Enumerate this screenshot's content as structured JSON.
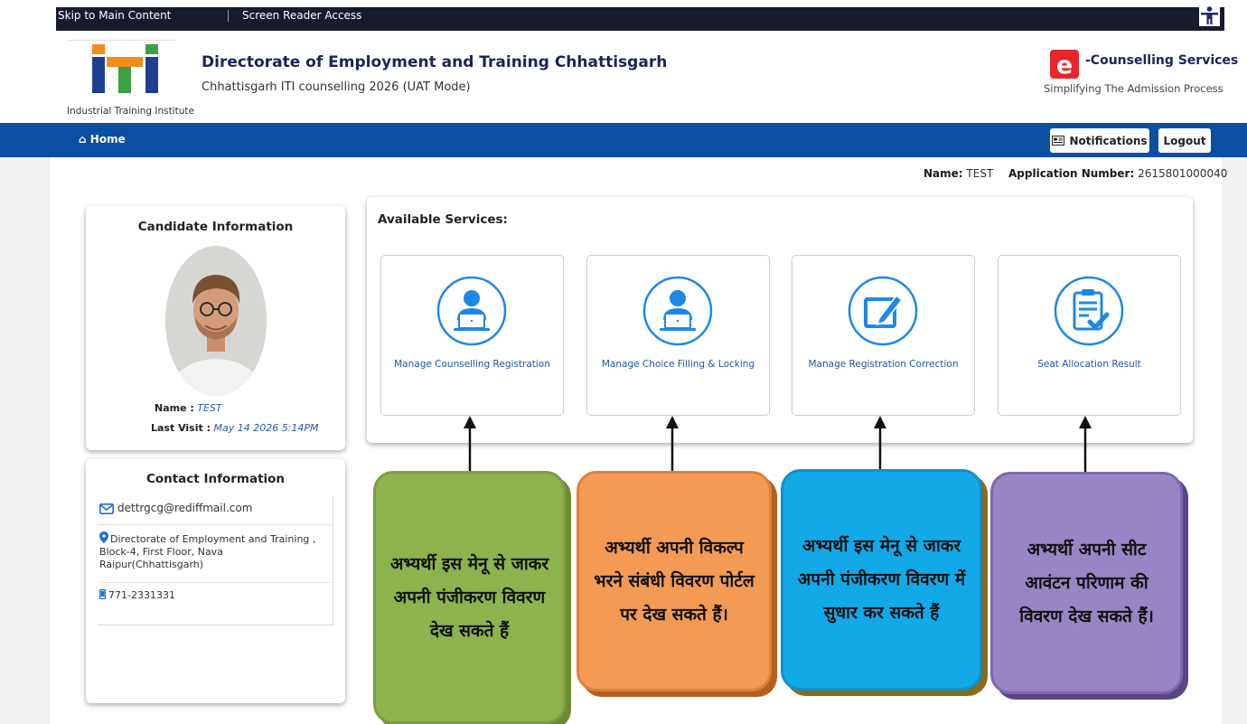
{
  "topbar": {
    "skip_link": "Skip to Main Content",
    "screen_reader_link": "Screen Reader Access"
  },
  "header": {
    "logo_caption": "Industrial Training Institute",
    "org_title": "Directorate of Employment and Training Chhattisgarh",
    "org_subtitle": "Chhattisgarh ITI counselling 2026 (UAT Mode)",
    "service_title": "-Counselling Services",
    "service_tagline": "Simplifying The Admission Process"
  },
  "nav": {
    "home": "Home",
    "notifications": "Notifications",
    "logout": "Logout"
  },
  "user": {
    "name_label": "Name:",
    "name_value": "TEST",
    "app_label": "Application Number:",
    "app_value": "2615801000040"
  },
  "candidate": {
    "title": "Candidate Information",
    "name_label": "Name :",
    "name_value": "TEST",
    "last_visit_label": "Last Visit :",
    "last_visit_value": "May 14 2026 5:14PM"
  },
  "contact": {
    "title": "Contact Information",
    "email": "dettrgcg@rediffmail.com",
    "address": "Directorate of Employment and Training , Block-4, First Floor, Nava Raipur(Chhattisgarh)",
    "phone": "771-2331331"
  },
  "services": {
    "title": "Available Services:",
    "items": [
      {
        "label": "Manage Counselling Registration",
        "icon": "user-laptop-icon"
      },
      {
        "label": "Manage Choice Filling & Locking",
        "icon": "user-laptop-icon"
      },
      {
        "label": "Manage Registration Correction",
        "icon": "edit-pencil-icon"
      },
      {
        "label": "Seat Allocation Result",
        "icon": "clipboard-check-icon"
      }
    ]
  },
  "callouts": [
    {
      "text": "अभ्यर्थी इस मेनू से जाकर अपनी पंजीकरण विवरण देख सकते हैं",
      "color": "#8db24e"
    },
    {
      "text": "अभ्यर्थी अपनी विकल्प भरने संबंधी विवरण पोर्टल पर देख सकते हैं।",
      "color": "#f39a55"
    },
    {
      "text": "अभ्यर्थी इस मेनू से जाकर अपनी पंजीकरण विवरण में सुधार कर सकते हैं",
      "color": "#12a9e8"
    },
    {
      "text": "अभ्यर्थी अपनी सीट आवंटन परिणाम की विवरण देख सकते हैं।",
      "color": "#9885c4"
    }
  ],
  "colors": {
    "nav_blue": "#0b4ea2",
    "topbar_dark": "#181a2e",
    "link_blue": "#1f57a8",
    "icon_blue": "#1e88e5"
  }
}
